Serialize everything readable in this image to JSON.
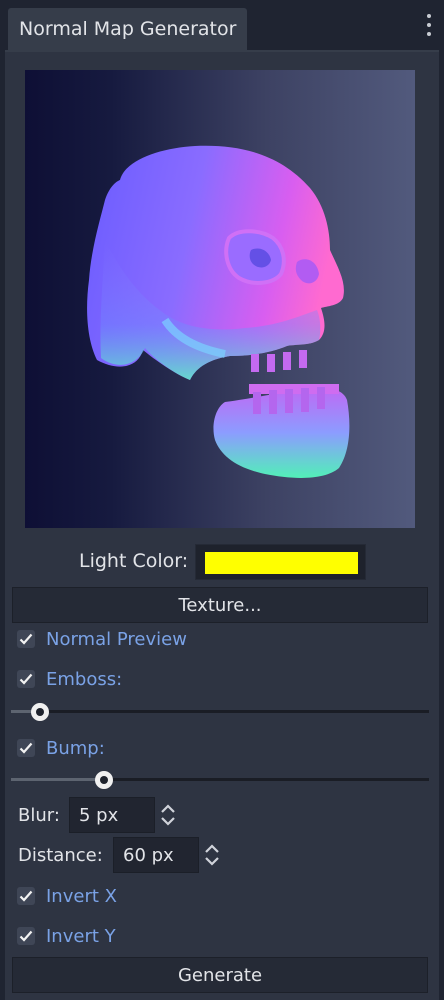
{
  "tab": {
    "title": "Normal Map Generator",
    "menu_icon": "kebab-menu-icon"
  },
  "preview": {
    "description_icon": "normal-map-preview-image"
  },
  "light_color": {
    "label": "Light Color:",
    "value": "#ffff00"
  },
  "texture_button": {
    "label": "Texture..."
  },
  "normal_preview": {
    "label": "Normal Preview",
    "checked": true
  },
  "emboss": {
    "label": "Emboss:",
    "checked": true,
    "value_fraction": 0.05
  },
  "bump": {
    "label": "Bump:",
    "checked": true,
    "value_fraction": 0.21
  },
  "blur": {
    "label": "Blur:",
    "value": "5 px"
  },
  "distance": {
    "label": "Distance:",
    "value": "60 px"
  },
  "invert_x": {
    "label": "Invert X",
    "checked": true
  },
  "invert_y": {
    "label": "Invert Y",
    "checked": true
  },
  "generate_button": {
    "label": "Generate"
  },
  "colors": {
    "accent_text": "#7aa2e6",
    "panel_bg": "#2e3442",
    "editor_bg": "#1f2431"
  }
}
